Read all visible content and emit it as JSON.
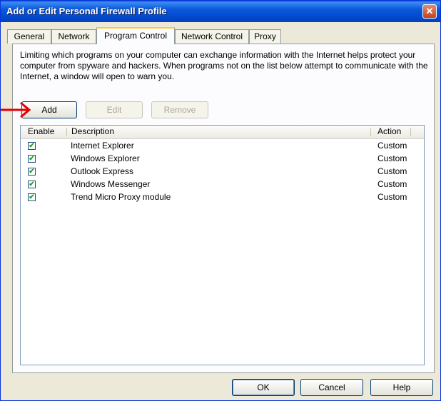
{
  "window": {
    "title": "Add or Edit Personal Firewall Profile",
    "close_symbol": "✕"
  },
  "tabs": [
    {
      "label": "General",
      "active": false
    },
    {
      "label": "Network",
      "active": false
    },
    {
      "label": "Program Control",
      "active": true
    },
    {
      "label": "Network Control",
      "active": false
    },
    {
      "label": "Proxy",
      "active": false
    }
  ],
  "panel": {
    "description": "Limiting which programs on your computer can exchange information with the Internet helps protect your computer from spyware and hackers. When programs not on the list below attempt to communicate with the Internet, a window will open to warn you.",
    "buttons": {
      "add": "Add",
      "edit": "Edit",
      "remove": "Remove"
    },
    "list": {
      "columns": {
        "enable": "Enable",
        "description": "Description",
        "action": "Action"
      },
      "rows": [
        {
          "checked": true,
          "description": "Internet Explorer",
          "action": "Custom"
        },
        {
          "checked": true,
          "description": "Windows Explorer",
          "action": "Custom"
        },
        {
          "checked": true,
          "description": "Outlook Express",
          "action": "Custom"
        },
        {
          "checked": true,
          "description": "Windows Messenger",
          "action": "Custom"
        },
        {
          "checked": true,
          "description": "Trend Micro Proxy module",
          "action": "Custom"
        }
      ]
    }
  },
  "footer": {
    "ok": "OK",
    "cancel": "Cancel",
    "help": "Help"
  },
  "colors": {
    "titlebar": "#0a58dc",
    "annotation_arrow": "#e30000",
    "checkmark": "#21a121"
  },
  "check_symbol": "✔"
}
